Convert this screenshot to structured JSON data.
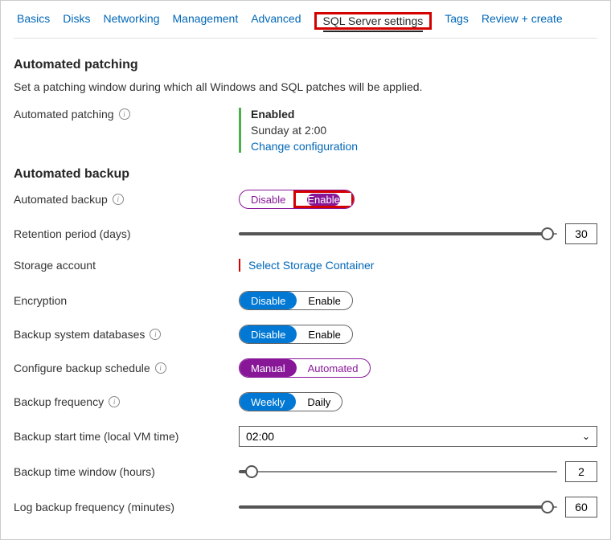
{
  "tabs": {
    "basics": "Basics",
    "disks": "Disks",
    "networking": "Networking",
    "management": "Management",
    "advanced": "Advanced",
    "sql": "SQL Server settings",
    "tags": "Tags",
    "review": "Review + create"
  },
  "patching": {
    "heading": "Automated patching",
    "desc": "Set a patching window during which all Windows and SQL patches will be applied.",
    "label": "Automated patching",
    "status": "Enabled",
    "schedule": "Sunday at 2:00",
    "change": "Change configuration"
  },
  "backup": {
    "heading": "Automated backup",
    "label": "Automated backup",
    "disable": "Disable",
    "enable": "Enable",
    "retention_label": "Retention period (days)",
    "retention_value": "30",
    "storage_label": "Storage account",
    "storage_link": "Select Storage Container",
    "encryption_label": "Encryption",
    "encryption_disable": "Disable",
    "encryption_enable": "Enable",
    "sysdbs_label": "Backup system databases",
    "sysdbs_disable": "Disable",
    "sysdbs_enable": "Enable",
    "schedcfg_label": "Configure backup schedule",
    "schedcfg_manual": "Manual",
    "schedcfg_auto": "Automated",
    "freq_label": "Backup frequency",
    "freq_weekly": "Weekly",
    "freq_daily": "Daily",
    "start_label": "Backup start time (local VM time)",
    "start_value": "02:00",
    "window_label": "Backup time window (hours)",
    "window_value": "2",
    "logfreq_label": "Log backup frequency (minutes)",
    "logfreq_value": "60"
  }
}
